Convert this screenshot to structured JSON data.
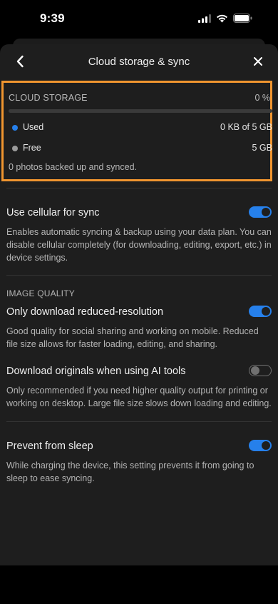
{
  "status_bar": {
    "time": "9:39",
    "icons": [
      "cellular-signal-icon",
      "wifi-icon",
      "battery-icon"
    ]
  },
  "header": {
    "title": "Cloud storage & sync",
    "back_icon": "chevron-left-icon",
    "close_icon": "close-icon"
  },
  "cloud_storage": {
    "label": "CLOUD STORAGE",
    "percent": "0 %",
    "usage_fraction": 0.0,
    "used_label": "Used",
    "used_value": "0 KB of 5 GB",
    "free_label": "Free",
    "free_value": "5 GB",
    "note": "0 photos backed up and synced.",
    "colors": {
      "used": "#2680eb",
      "free": "#9a9a9a",
      "highlight": "#f0952f"
    }
  },
  "settings": {
    "cellular": {
      "title": "Use cellular for sync",
      "desc": "Enables automatic syncing & backup using your data plan. You can disable cellular completely (for downloading, editing, export, etc.) in device settings.",
      "on": true
    },
    "image_quality_label": "IMAGE QUALITY",
    "reduced_res": {
      "title": "Only download reduced-resolution",
      "desc": "Good quality for social sharing and working on mobile. Reduced file size allows for faster loading, editing, and sharing.",
      "on": true
    },
    "ai_originals": {
      "title": "Download originals when using AI tools",
      "desc": "Only recommended if you need higher quality output for printing or working on desktop. Large file size slows down loading and editing.",
      "on": false
    },
    "prevent_sleep": {
      "title": "Prevent from sleep",
      "desc": "While charging the device, this setting prevents it from going to sleep to ease syncing.",
      "on": true
    }
  },
  "accent_color": "#2680eb"
}
